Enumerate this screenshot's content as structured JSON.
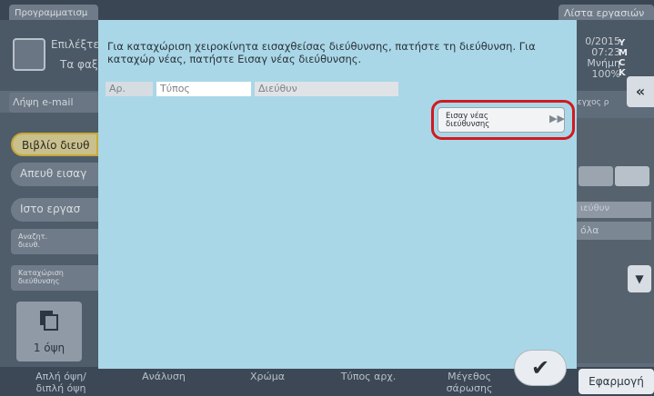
{
  "background": {
    "tabs": {
      "programs": "Προγραμματισμ",
      "job_list": "Λίστα εργασιών"
    },
    "header": {
      "select_text": "Επιλέξτε",
      "fax_text": "Τα φαξ"
    },
    "status": {
      "date": "0/2015",
      "time": "07:23",
      "memory_label": "Μνήμη",
      "memory_value": "100%",
      "ymck": "Y\nM\nC\nK"
    },
    "email_tab": "Λήψη e-mail",
    "control_label": "πλεγχος ρ",
    "left_buttons": [
      "Βιβλίο διευθ",
      "Απευθ εισαγ",
      "Ιστο εργασ"
    ],
    "small_buttons": [
      "Αναζητ.\nδιευθ.",
      "Καταχώριση\nδιεύθυνσης"
    ],
    "field_label": "ιεύθυν",
    "field_value": "όλα",
    "one_sided": "1 όψη",
    "bottom": [
      "Απλή όψη/\nδιπλή όψη",
      "Ανάλυση",
      "Χρώμα",
      "Τύπος αρχ.",
      "Μέγεθος\nσάρωσης"
    ],
    "apply": "Εφαρμογή"
  },
  "dialog": {
    "message": "Για καταχώριση χειροκίνητα εισαχθείσας διεύθυνσης, πατήστε τη διεύθυνση. Για καταχώρ νέας, πατήστε Εισαγ νέας διεύθυνσης.",
    "columns": {
      "number": "Αρ.",
      "type": "Τύπος",
      "address": "Διεύθυν"
    },
    "new_address_button": "Εισαγ νέας\nδιεύθυνσης",
    "ok_glyph": "✔",
    "highlight_color": "#d2191f"
  }
}
